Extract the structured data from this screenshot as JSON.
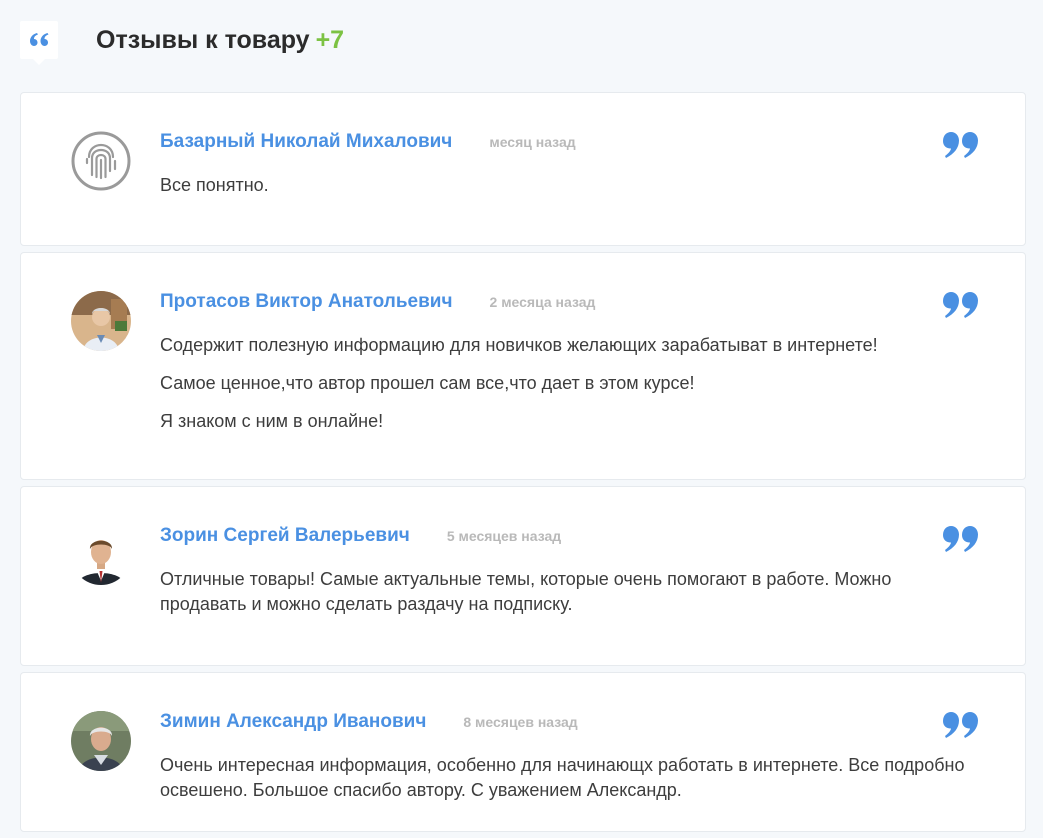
{
  "header": {
    "title": "Отзывы к товару",
    "count": "+7"
  },
  "reviews": [
    {
      "author": "Базарный Николай Михалович",
      "date": "месяц назад",
      "avatar": "fingerprint-avatar",
      "lines": [
        "Все понятно."
      ]
    },
    {
      "author": "Протасов Виктор Анатольевич",
      "date": "2 месяца назад",
      "avatar": "photo-avatar",
      "lines": [
        "Содержит полезную информацию для новичков желающих зарабатыват в интернете!",
        "Самое ценное,что автор прошел сам все,что дает в этом курсе!",
        "Я знаком с ним в онлайне!"
      ]
    },
    {
      "author": "Зорин Сергей Валерьевич",
      "date": "5 месяцев назад",
      "avatar": "photo-avatar",
      "lines": [
        "Отличные товары! Самые актуальные темы, которые очень помогают в работе. Можно продавать и можно сделать раздачу на подписку."
      ]
    },
    {
      "author": "Зимин Александр Иванович",
      "date": "8 месяцев назад",
      "avatar": "photo-avatar",
      "lines": [
        "Очень интересная информация, особенно для начинающх работать в интернете. Все подробно освешено. Большое спасибо автору. С уважением Александр."
      ]
    }
  ],
  "colors": {
    "accent": "#4a90e2",
    "count": "#7cc243",
    "date": "#b9b9b9",
    "background": "#f5f8fb"
  }
}
